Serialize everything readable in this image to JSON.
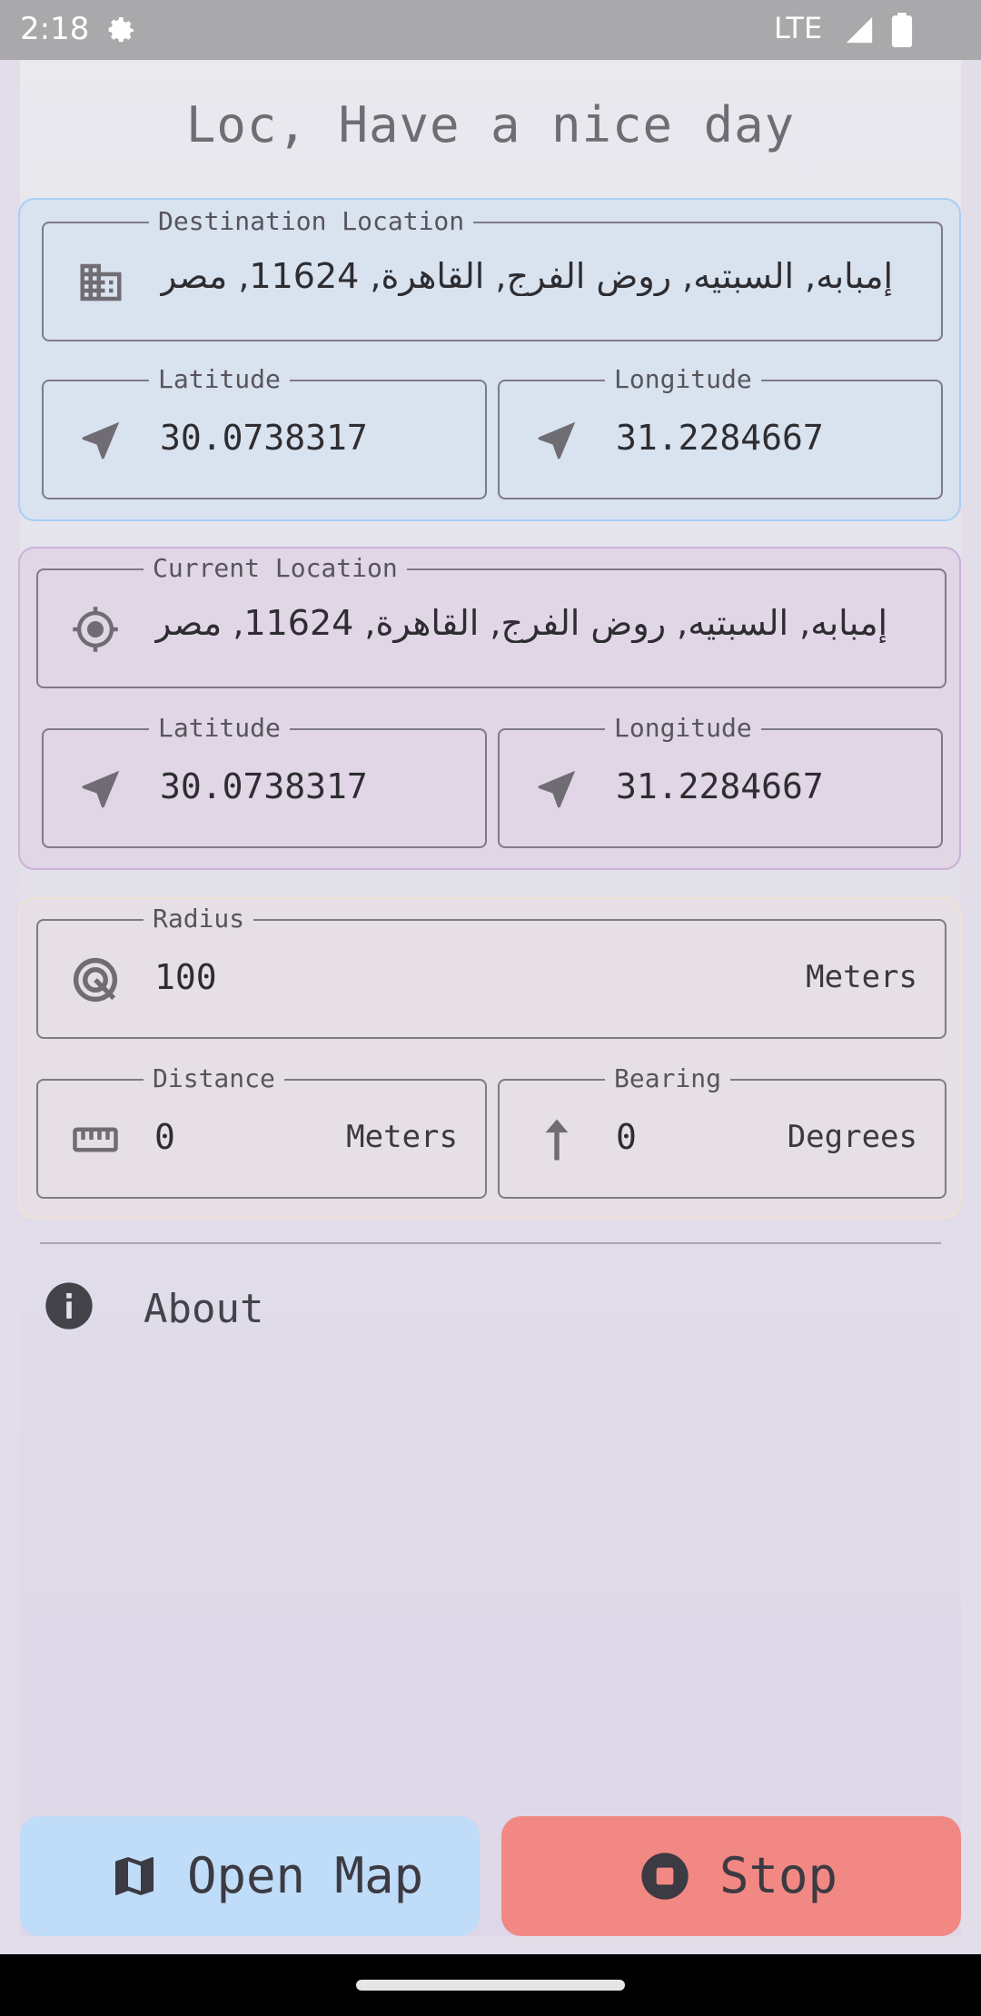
{
  "status_bar": {
    "time": "2:18",
    "network": "LTE"
  },
  "app": {
    "title": "Loc, Have a nice day"
  },
  "destination": {
    "label": "Destination Location",
    "address": "إمبابه, السبتيه, روض الفرج, القاهرة, 11624, مصر",
    "latitude_label": "Latitude",
    "latitude": "30.0738317",
    "longitude_label": "Longitude",
    "longitude": "31.2284667"
  },
  "current": {
    "label": "Current Location",
    "address": "إمبابه, السبتيه, روض الفرج, القاهرة, 11624, مصر",
    "latitude_label": "Latitude",
    "latitude": "30.0738317",
    "longitude_label": "Longitude",
    "longitude": "31.2284667"
  },
  "radius": {
    "label": "Radius",
    "value": "100",
    "unit": "Meters"
  },
  "distance": {
    "label": "Distance",
    "value": "0",
    "unit": "Meters"
  },
  "bearing": {
    "label": "Bearing",
    "value": "0",
    "unit": "Degrees"
  },
  "about": {
    "label": "About"
  },
  "buttons": {
    "open_map": "Open Map",
    "stop": "Stop"
  },
  "icons": {
    "destination": "building-icon",
    "coordinate": "navigation-arrow-icon",
    "current": "gps-crosshair-icon",
    "radius": "radius-target-icon",
    "distance": "ruler-icon",
    "bearing": "arrow-up-icon",
    "about": "info-icon",
    "open_map": "map-icon",
    "stop": "stop-circle-icon"
  },
  "colors": {
    "destination_card": "#d9e2ef",
    "current_card": "#e0d6e6",
    "radius_card": "#e6dfe6",
    "open_map_button": "#bfdcf8",
    "stop_button": "#f28883"
  }
}
